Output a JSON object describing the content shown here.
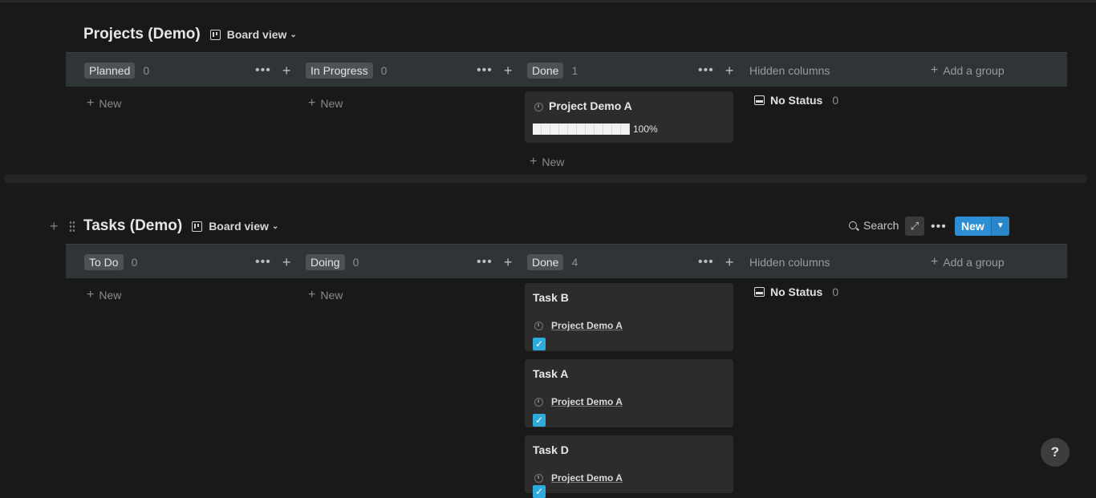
{
  "projects": {
    "title": "Projects (Demo)",
    "view_label": "Board view",
    "groups": [
      {
        "label": "Planned",
        "count": "0"
      },
      {
        "label": "In Progress",
        "count": "0"
      },
      {
        "label": "Done",
        "count": "1"
      }
    ],
    "hidden_columns_label": "Hidden columns",
    "add_group_label": "Add a group",
    "new_label": "New",
    "no_status_label": "No Status",
    "no_status_count": "0",
    "card": {
      "title": "Project Demo A",
      "progress_text": "100%",
      "progress": 1.0
    }
  },
  "tasks": {
    "title": "Tasks (Demo)",
    "view_label": "Board view",
    "search_label": "Search",
    "new_button_label": "New",
    "groups": [
      {
        "label": "To Do",
        "count": "0"
      },
      {
        "label": "Doing",
        "count": "0"
      },
      {
        "label": "Done",
        "count": "4"
      }
    ],
    "hidden_columns_label": "Hidden columns",
    "add_group_label": "Add a group",
    "new_label": "New",
    "no_status_label": "No Status",
    "no_status_count": "0",
    "cards": [
      {
        "title": "Task B",
        "relation": "Project Demo A",
        "checked": true
      },
      {
        "title": "Task A",
        "relation": "Project Demo A",
        "checked": true
      },
      {
        "title": "Task D",
        "relation": "Project Demo A",
        "checked": true
      }
    ]
  },
  "help_label": "?",
  "colors": {
    "accent": "#2c8fd6",
    "background": "#191919",
    "group_bar": "#2f3437",
    "card": "#2c2c2c"
  }
}
